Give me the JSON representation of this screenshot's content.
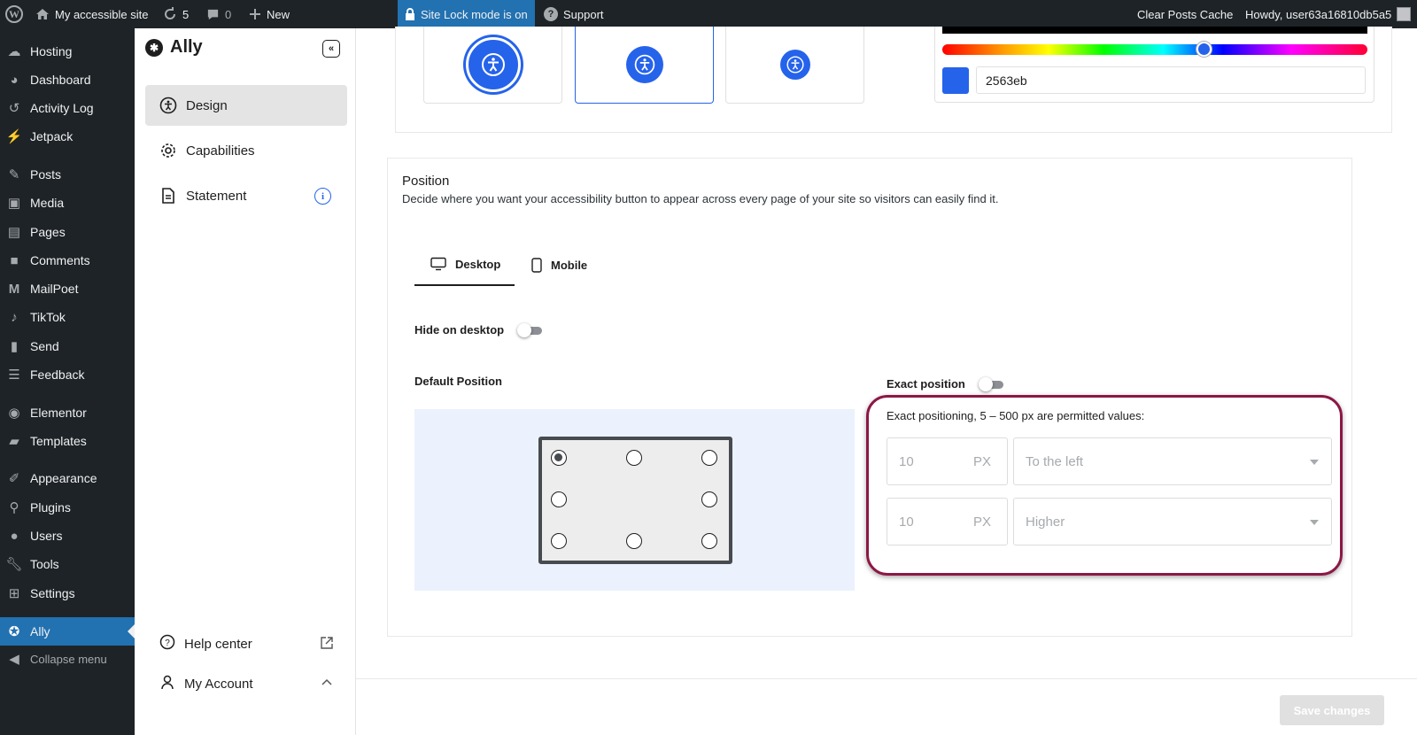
{
  "adminbar": {
    "site_name": "My accessible site",
    "updates_count": "5",
    "comments_count": "0",
    "new_label": "New",
    "site_lock": "Site Lock mode is on",
    "support": "Support",
    "clear_cache": "Clear Posts Cache",
    "howdy": "Howdy, user63a16810db5a5"
  },
  "menu": {
    "items": [
      {
        "label": "Hosting",
        "icon": "cloud-icon"
      },
      {
        "label": "Dashboard",
        "icon": "dashboard-icon"
      },
      {
        "label": "Activity Log",
        "icon": "history-icon"
      },
      {
        "label": "Jetpack",
        "icon": "jetpack-icon"
      },
      {
        "label": "Posts",
        "icon": "pin-icon"
      },
      {
        "label": "Media",
        "icon": "media-icon"
      },
      {
        "label": "Pages",
        "icon": "pages-icon"
      },
      {
        "label": "Comments",
        "icon": "comment-icon"
      },
      {
        "label": "MailPoet",
        "icon": "mailpoet-icon"
      },
      {
        "label": "TikTok",
        "icon": "tiktok-icon"
      },
      {
        "label": "Send",
        "icon": "send-icon"
      },
      {
        "label": "Feedback",
        "icon": "feedback-icon"
      },
      {
        "label": "Elementor",
        "icon": "elementor-icon"
      },
      {
        "label": "Templates",
        "icon": "folder-icon"
      },
      {
        "label": "Appearance",
        "icon": "brush-icon"
      },
      {
        "label": "Plugins",
        "icon": "plugin-icon"
      },
      {
        "label": "Users",
        "icon": "user-icon"
      },
      {
        "label": "Tools",
        "icon": "wrench-icon"
      },
      {
        "label": "Settings",
        "icon": "settings-icon"
      },
      {
        "label": "Ally",
        "icon": "accessibility-icon"
      }
    ],
    "collapse": "Collapse menu"
  },
  "ally_panel": {
    "brand": "Ally",
    "nav": [
      {
        "label": "Design"
      },
      {
        "label": "Capabilities"
      },
      {
        "label": "Statement"
      }
    ],
    "help": "Help center",
    "account": "My Account"
  },
  "design": {
    "color_hex": "2563eb",
    "accent": "#2563eb"
  },
  "position": {
    "title": "Position",
    "description": "Decide where you want your accessibility button to appear across every page of your site so visitors can easily find it.",
    "tabs": [
      "Desktop",
      "Mobile"
    ],
    "hide_label": "Hide on desktop",
    "default_label": "Default Position",
    "exact_label": "Exact position",
    "exact_note": "Exact positioning, 5 – 500 px are permitted values:",
    "horizontal_value": "10",
    "horizontal_unit": "PX",
    "horizontal_direction": "To the left",
    "vertical_value": "10",
    "vertical_unit": "PX",
    "vertical_direction": "Higher"
  },
  "footer": {
    "save": "Save changes"
  }
}
